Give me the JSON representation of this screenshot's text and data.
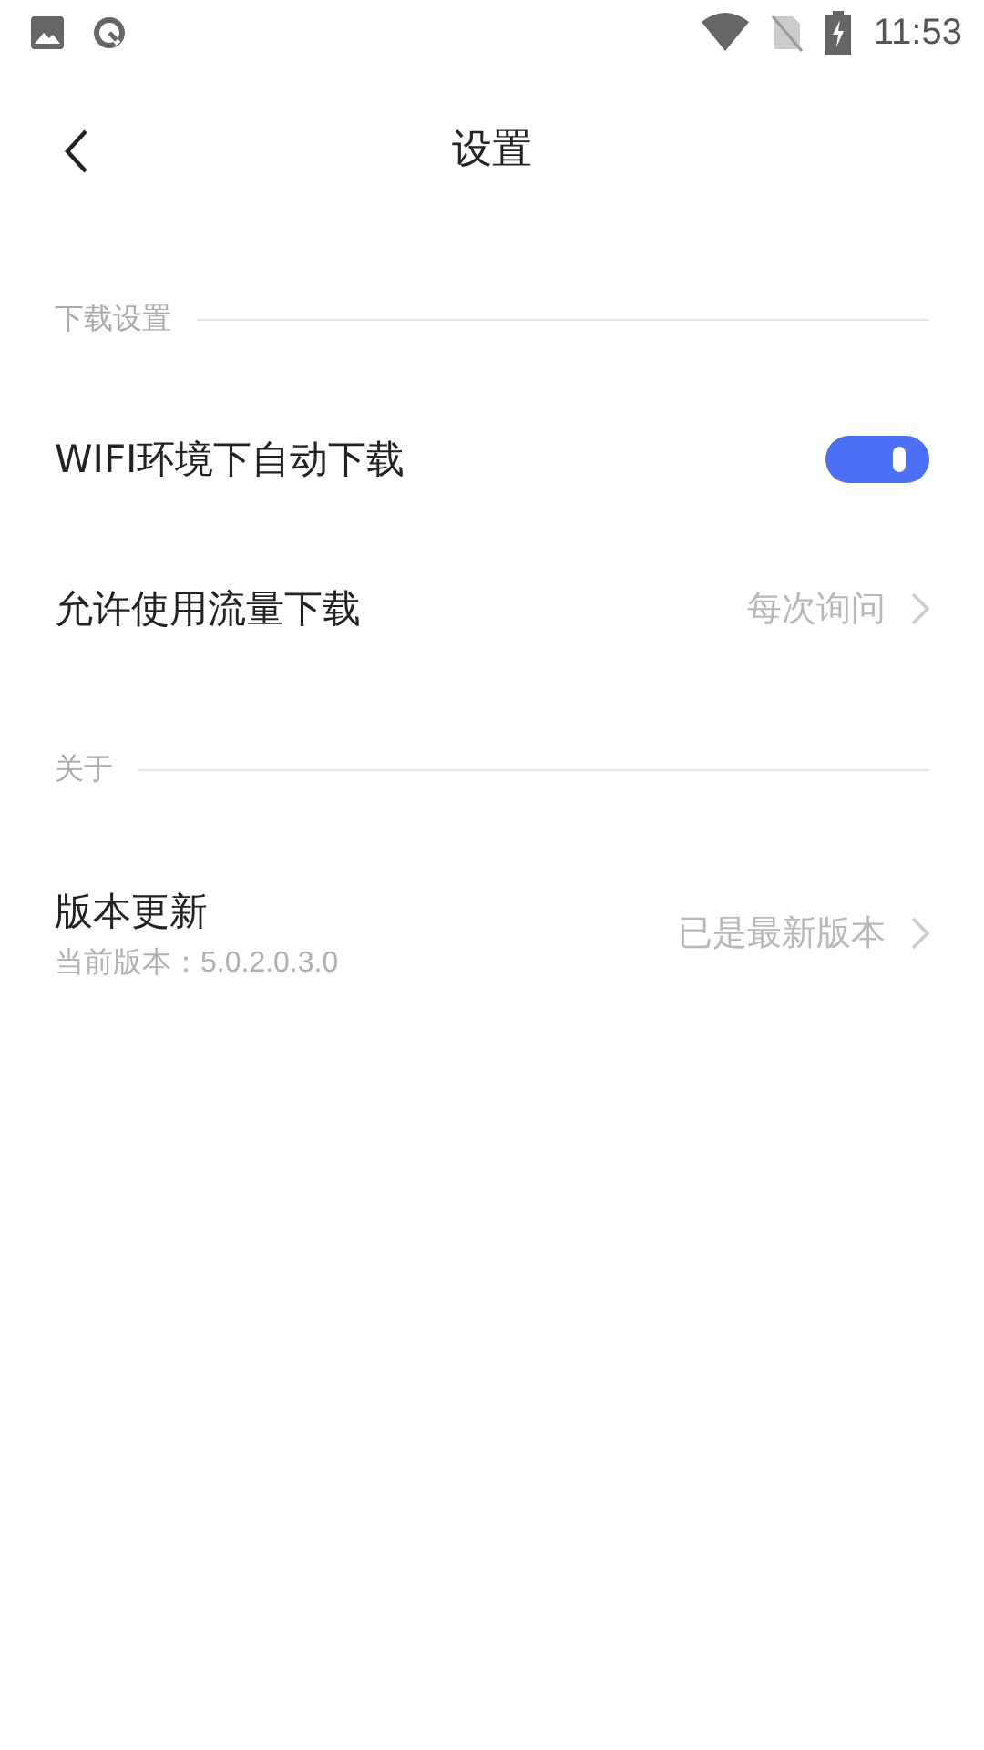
{
  "status_bar": {
    "time": "11:53"
  },
  "nav": {
    "title": "设置"
  },
  "sections": [
    {
      "title": "下载设置",
      "items": [
        {
          "kind": "toggle",
          "label": "WIFI环境下自动下载",
          "on": true
        },
        {
          "kind": "link",
          "label": "允许使用流量下载",
          "value": "每次询问"
        }
      ]
    },
    {
      "title": "关于",
      "items": [
        {
          "kind": "link",
          "label": "版本更新",
          "subtitle": "当前版本：5.0.2.0.3.0",
          "value": "已是最新版本"
        }
      ]
    }
  ]
}
